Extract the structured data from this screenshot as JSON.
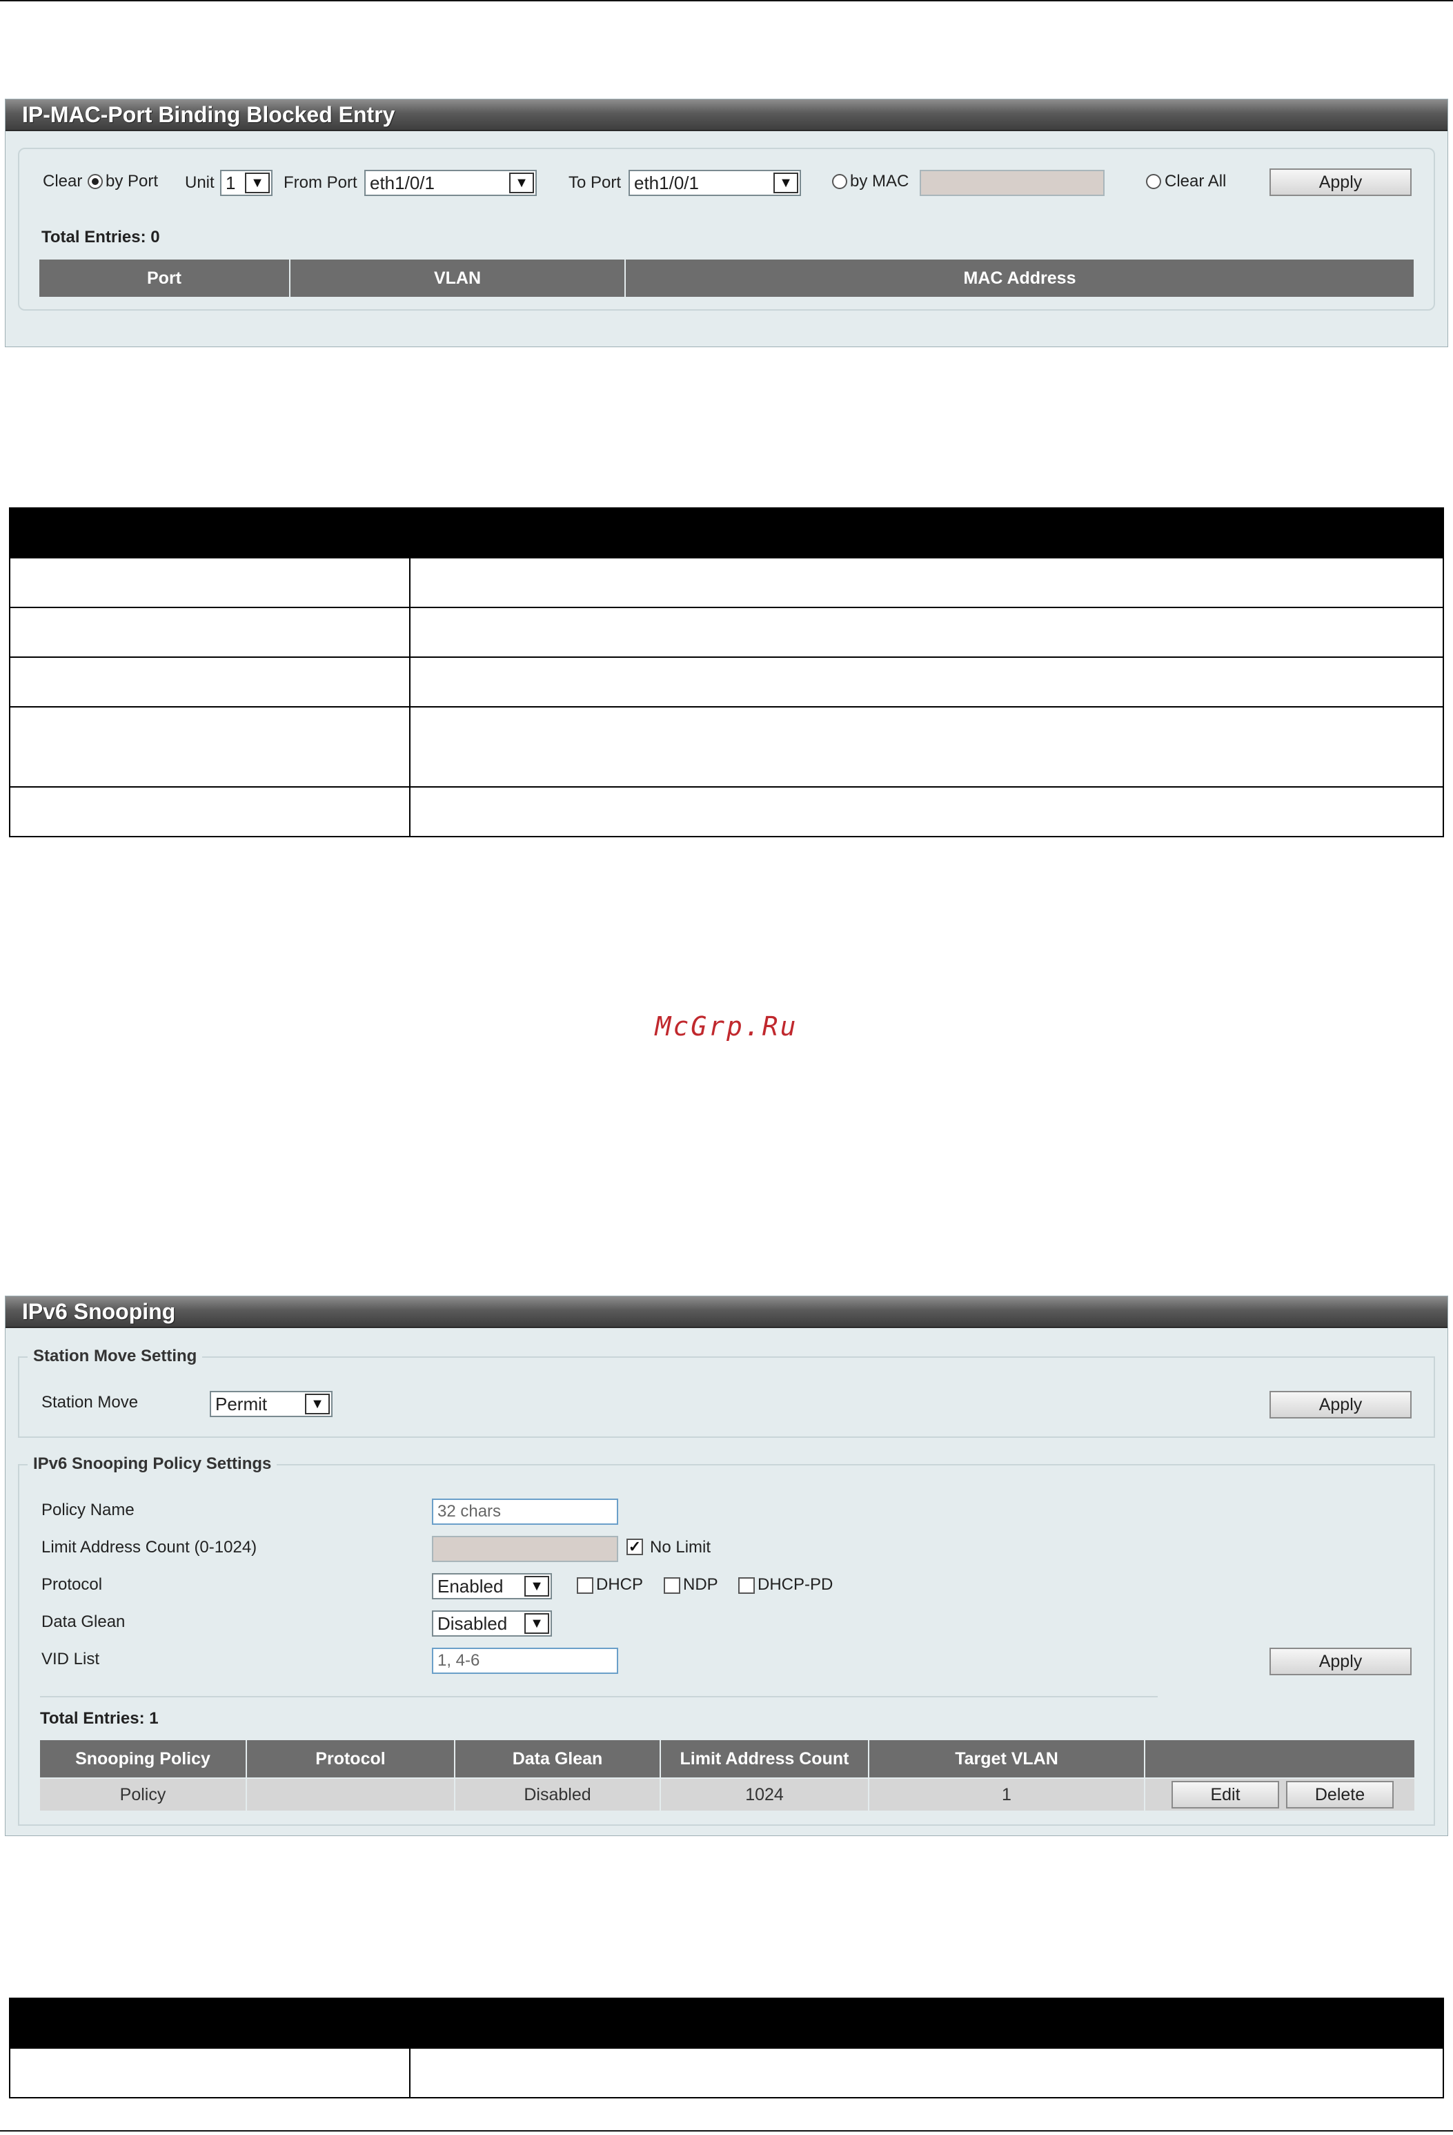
{
  "blocked": {
    "title": "IP-MAC-Port Binding Blocked Entry",
    "clear_label": "Clear",
    "by_port_label": "by Port",
    "unit_label": "Unit",
    "unit_value": "1",
    "from_port_label": "From Port",
    "from_port_value": "eth1/0/1",
    "to_port_label": "To Port",
    "to_port_value": "eth1/0/1",
    "by_mac_label": "by MAC",
    "clear_all_label": "Clear All",
    "apply_label": "Apply",
    "total_entries": "Total Entries: 0",
    "columns": [
      "Port",
      "VLAN",
      "MAC Address"
    ]
  },
  "watermark": "McGrp.Ru",
  "snooping": {
    "title": "IPv6 Snooping",
    "station_move": {
      "legend": "Station Move Setting",
      "label": "Station Move",
      "value": "Permit",
      "apply_label": "Apply"
    },
    "policy": {
      "legend": "IPv6 Snooping Policy Settings",
      "policy_name_label": "Policy Name",
      "policy_name_placeholder": "32 chars",
      "limit_label": "Limit Address Count (0-1024)",
      "no_limit_label": "No Limit",
      "protocol_label": "Protocol",
      "protocol_value": "Enabled",
      "dhcp_label": "DHCP",
      "ndp_label": "NDP",
      "dhcp_pd_label": "DHCP-PD",
      "data_glean_label": "Data Glean",
      "data_glean_value": "Disabled",
      "vid_list_label": "VID List",
      "vid_list_placeholder": "1, 4-6",
      "apply_label": "Apply"
    },
    "total_entries": "Total Entries: 1",
    "columns": [
      "Snooping Policy",
      "Protocol",
      "Data Glean",
      "Limit Address Count",
      "Target VLAN"
    ],
    "rows": [
      {
        "policy": "Policy",
        "protocol": "",
        "data_glean": "Disabled",
        "limit": "1024",
        "target_vlan": "1",
        "edit_label": "Edit",
        "delete_label": "Delete"
      }
    ]
  }
}
